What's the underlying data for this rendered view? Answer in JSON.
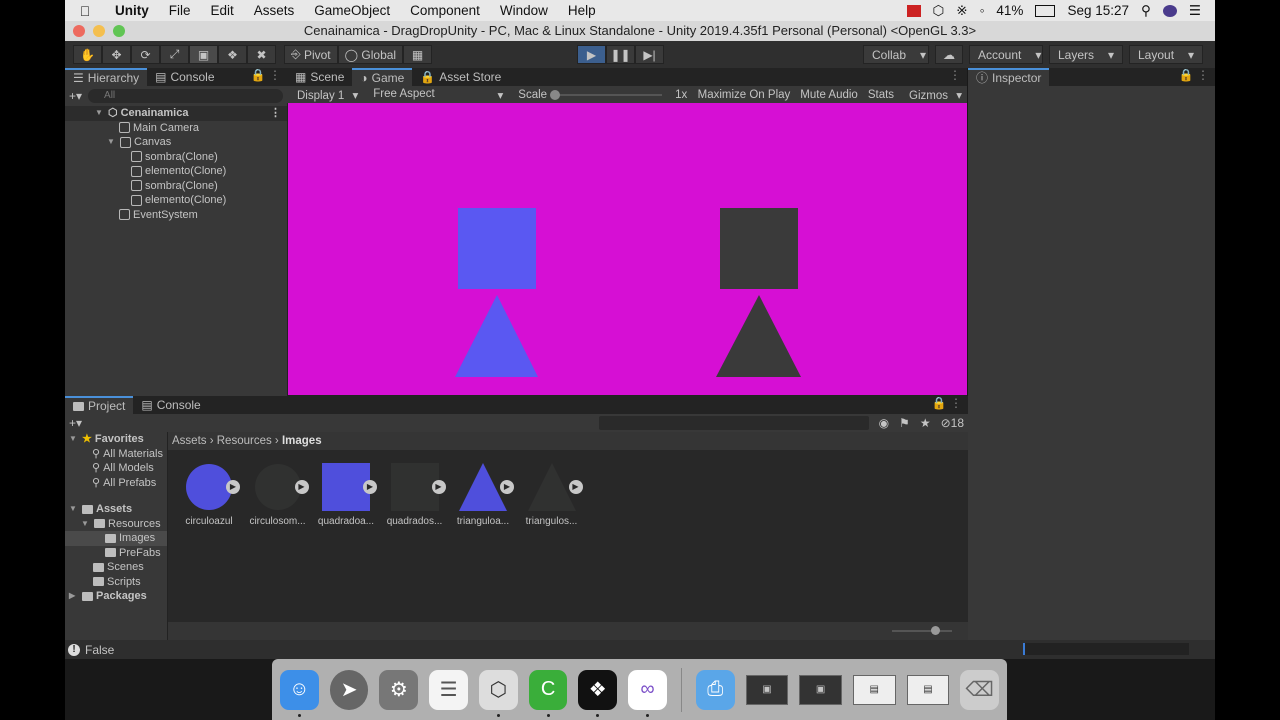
{
  "menubar": {
    "app": "Unity",
    "menus": [
      "File",
      "Edit",
      "Assets",
      "GameObject",
      "Component",
      "Window",
      "Help"
    ],
    "battery": "41%",
    "clock": "Seg 15:27"
  },
  "window": {
    "title": "Cenainamica - DragDropUnity - PC, Mac & Linux Standalone - Unity 2019.4.35f1 Personal (Personal) <OpenGL 3.3>"
  },
  "toolbar": {
    "pivot": "Pivot",
    "global": "Global",
    "collab": "Collab",
    "account": "Account",
    "layers": "Layers",
    "layout": "Layout"
  },
  "hierarchy": {
    "tabs": [
      "Hierarchy",
      "Console"
    ],
    "search_placeholder": "All",
    "root": "Cenainamica",
    "items": [
      {
        "label": "Main Camera"
      },
      {
        "label": "Canvas"
      },
      {
        "label": "sombra(Clone)"
      },
      {
        "label": "elemento(Clone)"
      },
      {
        "label": "sombra(Clone)"
      },
      {
        "label": "elemento(Clone)"
      },
      {
        "label": "EventSystem"
      }
    ]
  },
  "gameview": {
    "tabs": [
      "Scene",
      "Game",
      "Asset Store"
    ],
    "display": "Display 1",
    "aspect": "Free Aspect",
    "scale_label": "Scale",
    "scale_value": "1x",
    "maximize": "Maximize On Play",
    "mute": "Mute Audio",
    "stats": "Stats",
    "gizmos": "Gizmos",
    "colors": {
      "background": "#d60fd4",
      "blue": "#5a58f2",
      "dark": "#3a3a3a"
    }
  },
  "inspector": {
    "tab": "Inspector"
  },
  "project": {
    "tabs": [
      "Project",
      "Console"
    ],
    "count": "18",
    "favorites": "Favorites",
    "favorite_items": [
      "All Materials",
      "All Models",
      "All Prefabs"
    ],
    "assets_root": "Assets",
    "folders": [
      "Resources",
      "Images",
      "PreFabs",
      "Scenes",
      "Scripts"
    ],
    "packages": "Packages",
    "breadcrumb": [
      "Assets",
      "Resources",
      "Images"
    ],
    "items": [
      {
        "name": "circuloazul",
        "shape": "circle",
        "color": "#4f4fdc"
      },
      {
        "name": "circulosom...",
        "shape": "circle",
        "color": "#303130"
      },
      {
        "name": "quadradoa...",
        "shape": "square",
        "color": "#4f4fdc"
      },
      {
        "name": "quadrados...",
        "shape": "square",
        "color": "#303130"
      },
      {
        "name": "trianguloa...",
        "shape": "triangle",
        "color": "#4f4fdc"
      },
      {
        "name": "triangulos...",
        "shape": "triangle",
        "color": "#303130"
      }
    ]
  },
  "status": {
    "message": "False"
  }
}
